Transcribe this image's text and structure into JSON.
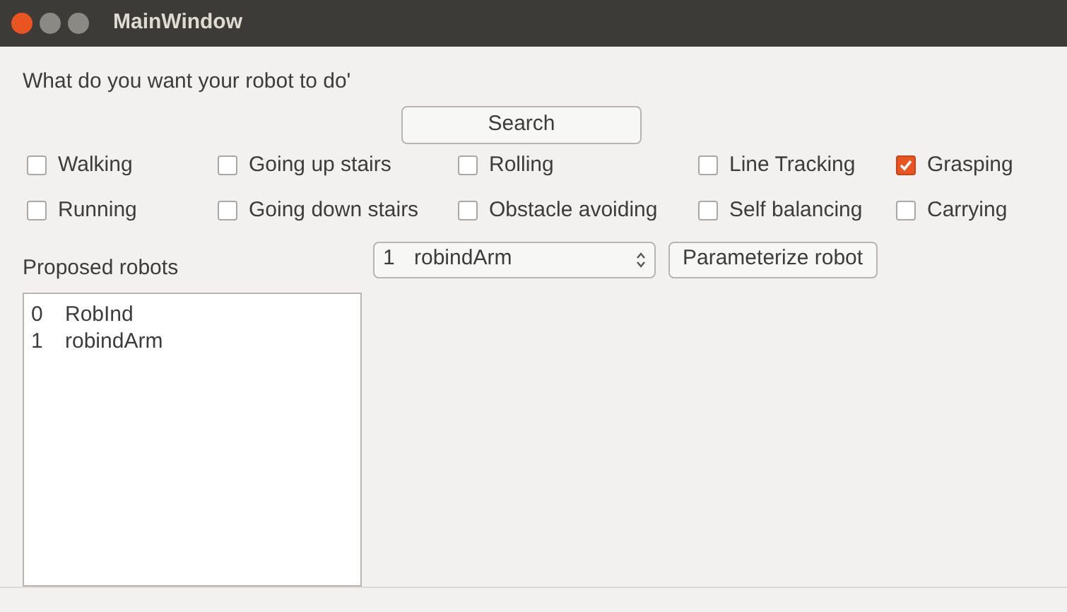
{
  "window": {
    "title": "MainWindow"
  },
  "prompt": "What do you want your robot to do'",
  "search_button": "Search",
  "options": [
    {
      "label": "Walking",
      "checked": false
    },
    {
      "label": "Going up stairs",
      "checked": false
    },
    {
      "label": "Rolling",
      "checked": false
    },
    {
      "label": "Line Tracking",
      "checked": false
    },
    {
      "label": "Grasping",
      "checked": true
    },
    {
      "label": "Running",
      "checked": false
    },
    {
      "label": "Going down stairs",
      "checked": false
    },
    {
      "label": "Obstacle avoiding",
      "checked": false
    },
    {
      "label": "Self balancing",
      "checked": false
    },
    {
      "label": "Carrying",
      "checked": false
    }
  ],
  "proposed": {
    "title": "Proposed robots",
    "items": [
      {
        "index": "0",
        "name": "RobInd"
      },
      {
        "index": "1",
        "name": "robindArm"
      }
    ]
  },
  "robot_select": {
    "index": "1",
    "name": "robindArm"
  },
  "parameterize_button": "Parameterize robot"
}
